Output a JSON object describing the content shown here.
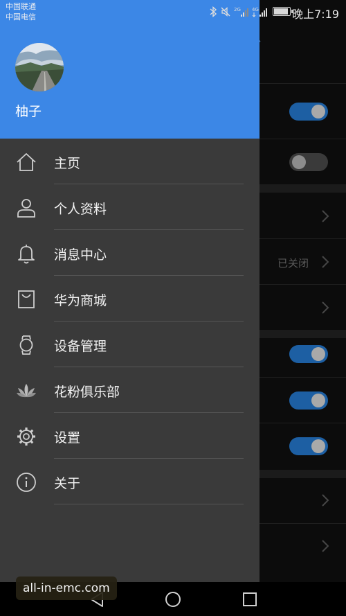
{
  "status_bar": {
    "carrier_1": "中国联通",
    "carrier_2": "中国电信",
    "network_1": "2G",
    "network_2": "4G",
    "time": "晚上7:19"
  },
  "drawer": {
    "username": "柚子",
    "header_color": "#3c87e6",
    "menu": [
      {
        "label": "主页",
        "icon": "home-icon"
      },
      {
        "label": "个人资料",
        "icon": "person-icon"
      },
      {
        "label": "消息中心",
        "icon": "bell-icon"
      },
      {
        "label": "华为商城",
        "icon": "shopping-bag-icon"
      },
      {
        "label": "设备管理",
        "icon": "watch-icon"
      },
      {
        "label": "花粉俱乐部",
        "icon": "lotus-icon"
      },
      {
        "label": "设置",
        "icon": "gear-icon"
      },
      {
        "label": "关于",
        "icon": "info-icon"
      }
    ]
  },
  "background_settings": {
    "closed_value": "已关闭",
    "toggles": [
      true,
      false,
      true,
      true,
      true
    ],
    "toggle_on_color": "#1d5fa3"
  },
  "watermark": "all-in-emc.com"
}
